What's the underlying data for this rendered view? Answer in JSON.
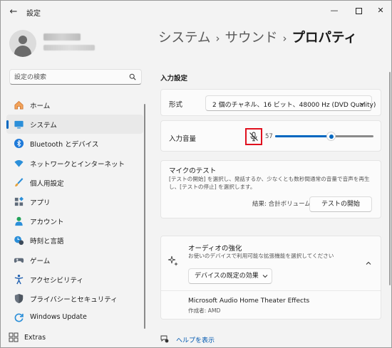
{
  "window": {
    "title": "設定",
    "back_glyph": "←",
    "min_glyph": "—",
    "close_glyph": "✕"
  },
  "search": {
    "placeholder": "設定の検索"
  },
  "nav": {
    "items": [
      {
        "label": "ホーム",
        "icon": "home-icon"
      },
      {
        "label": "システム",
        "icon": "system-icon",
        "selected": true
      },
      {
        "label": "Bluetooth とデバイス",
        "icon": "bluetooth-icon"
      },
      {
        "label": "ネットワークとインターネット",
        "icon": "wifi-icon"
      },
      {
        "label": "個人用設定",
        "icon": "brush-icon"
      },
      {
        "label": "アプリ",
        "icon": "apps-icon"
      },
      {
        "label": "アカウント",
        "icon": "account-icon"
      },
      {
        "label": "時刻と言語",
        "icon": "time-language-icon"
      },
      {
        "label": "ゲーム",
        "icon": "gamepad-icon"
      },
      {
        "label": "アクセシビリティ",
        "icon": "accessibility-icon"
      },
      {
        "label": "プライバシーとセキュリティ",
        "icon": "shield-icon"
      },
      {
        "label": "Windows Update",
        "icon": "windows-update-icon"
      }
    ],
    "extras_label": "Extras"
  },
  "breadcrumb": {
    "items": [
      "システム",
      "サウンド",
      "プロパティ"
    ],
    "sep": "›"
  },
  "input_settings": {
    "section_title": "入力設定",
    "format": {
      "label": "形式",
      "value": "2 個のチャネル、16 ビット、48000 Hz (DVD Quality)"
    },
    "volume": {
      "label": "入力音量",
      "value": "57",
      "fraction": 0.57,
      "muted": true
    },
    "mic_test": {
      "title": "マイクのテスト",
      "description": "[テストの開始] を選択し、発話するか、少なくとも数秒間通常の音量で音声を再生し、[テストの停止] を選択します。",
      "result": "結果: 合計ボリュームの 0%",
      "start_button": "テストの開始"
    }
  },
  "audio_enhancements": {
    "title": "オーディオの強化",
    "description": "お使いのデバイスで利用可能な拡張機能を選択してください",
    "dropdown_value": "デバイスの既定の効果",
    "effect_name": "Microsoft Audio Home Theater Effects",
    "effect_author": "作成者: AMD"
  },
  "help": {
    "label": "ヘルプを表示"
  },
  "colors": {
    "accent": "#0067c0",
    "highlight": "#e0101e"
  }
}
